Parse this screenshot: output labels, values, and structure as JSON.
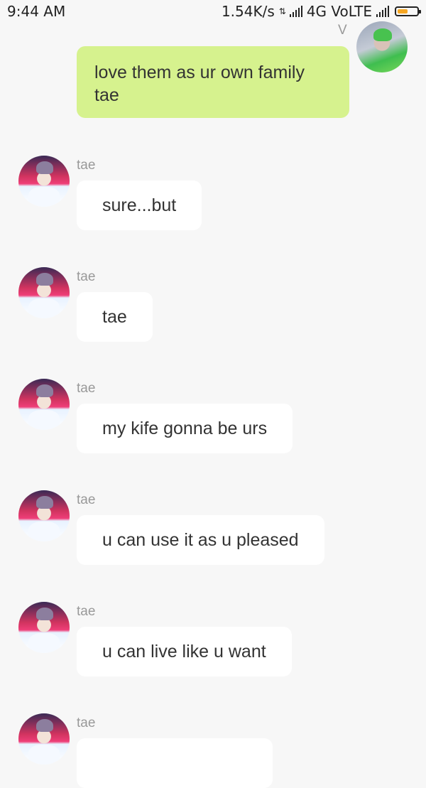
{
  "status_bar": {
    "time": "9:44 AM",
    "speed": "1.54K/s",
    "network": "4G VoLTE",
    "battery_level": 0.55,
    "battery_color": "#f5a623"
  },
  "outgoing": {
    "sender": "V",
    "text": "love them as ur own family tae",
    "bubble_color": "#d6f28e"
  },
  "incoming": [
    {
      "sender": "tae",
      "text": "sure...but"
    },
    {
      "sender": "tae",
      "text": "tae"
    },
    {
      "sender": "tae",
      "text": "my kife gonna be urs"
    },
    {
      "sender": "tae",
      "text": "u can use it as u pleased"
    },
    {
      "sender": "tae",
      "text": "u can live like u want"
    },
    {
      "sender": "tae",
      "text": ""
    }
  ]
}
